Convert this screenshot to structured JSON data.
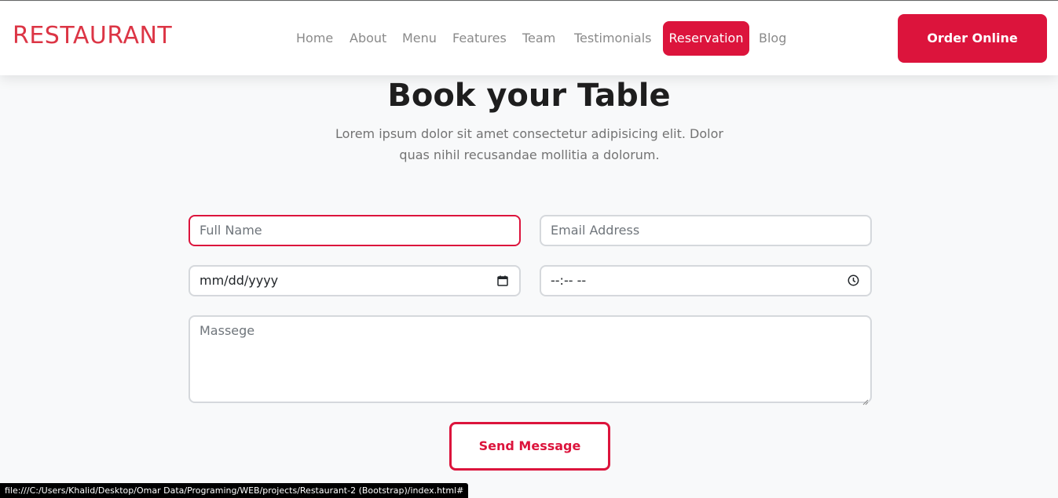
{
  "brand": "RESTAURANT",
  "nav": {
    "items": [
      {
        "label": "Home"
      },
      {
        "label": "About"
      },
      {
        "label": "Menu"
      },
      {
        "label": "Features"
      },
      {
        "label": "Team"
      },
      {
        "label": "Testimonials"
      },
      {
        "label": "Reservation",
        "active": true
      },
      {
        "label": "Blog"
      }
    ],
    "cta_label": "Order Online"
  },
  "section": {
    "title": "Book your Table",
    "subtitle_line1": "Lorem ipsum dolor sit amet consectetur adipisicing elit. Dolor",
    "subtitle_line2": "quas nihil recusandae mollitia a dolorum."
  },
  "form": {
    "full_name_placeholder": "Full Name",
    "email_placeholder": "Email Address",
    "date_value": "mm/dd/yyyy",
    "time_value": "--:-- --",
    "message_placeholder": "Massege",
    "send_label": "Send Message"
  },
  "status_bar": {
    "url": "file:///C:/Users/Khalid/Desktop/Omar Data/Programing/WEB/projects/Restaurant-2 (Bootstrap)/index.html#"
  },
  "colors": {
    "accent": "#dc143c",
    "brand_text": "#dc3545"
  }
}
